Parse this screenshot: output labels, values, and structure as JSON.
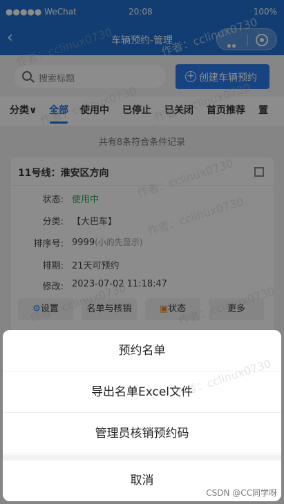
{
  "status_bar": {
    "carrier": "●●●●● WeChat",
    "time": "20:08",
    "battery": "100%"
  },
  "nav": {
    "title": "车辆预约-管理"
  },
  "search": {
    "placeholder": "搜索标题"
  },
  "create_button": {
    "label": "创建车辆预约"
  },
  "tabs": {
    "category": "分类∨",
    "items": [
      "全部",
      "使用中",
      "已停止",
      "已关闭",
      "首页推荐",
      "置"
    ]
  },
  "result_count": "共有8条符合条件记录",
  "card": {
    "title": "11号线：淮安区方向",
    "fields": [
      {
        "key": "状态:",
        "value": "使用中"
      },
      {
        "key": "分类:",
        "value": "【大巴车】"
      },
      {
        "key": "排序号:",
        "value": "9999",
        "hint": "(小的先显示)"
      },
      {
        "key": "排期:",
        "value": "21天可预约"
      },
      {
        "key": "修改:",
        "value": "2023-07-02 11:18:47"
      }
    ],
    "actions": [
      "设置",
      "名单与核销",
      "状态",
      "更多"
    ]
  },
  "action_sheet": {
    "options": [
      "预约名单",
      "导出名单Excel文件",
      "管理员核销预约码"
    ],
    "cancel": "取消"
  },
  "watermark": "作者：cclinux0730",
  "credit": "CSDN @CC同学呀"
}
